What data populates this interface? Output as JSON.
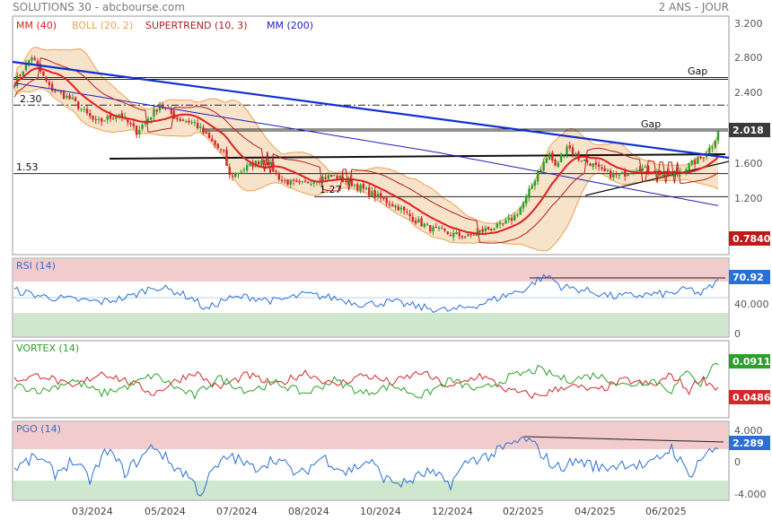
{
  "header": {
    "source": "SOLUTIONS 30 - abcbourse.com",
    "period": "2 ANS - JOUR"
  },
  "colors": {
    "ma40": "#e02020",
    "boll": "#f0a050",
    "supertrend": "#b02020",
    "ma200": "#2020c0",
    "bull": "#2ca02c",
    "bear": "#d62728",
    "blue_line": "#1030d0",
    "rsi_line": "#2a6fd6",
    "vortex_plus": "#2ca02c",
    "vortex_minus": "#d62728",
    "pgo_line": "#2a6fd6",
    "overbought_zone": "#f0c8c8",
    "oversold_zone": "#cfe5cf"
  },
  "x_axis_labels": [
    "03/2024",
    "05/2024",
    "07/2024",
    "08/2024",
    "10/2024",
    "12/2024",
    "02/2025",
    "04/2025",
    "06/2025"
  ],
  "chart_data": [
    {
      "type": "candlestick",
      "name": "price",
      "legend": [
        "MM (40)",
        "BOLL (20, 2)",
        "SUPERTREND (10, 3)",
        "MM (200)"
      ],
      "y_ticks": [
        "3.200",
        "2.800",
        "2.400",
        "1.600",
        "1.200"
      ],
      "ylim": [
        0.78,
        3.2
      ],
      "last_value": "2.018",
      "low_marker": "0.7840",
      "price_path": [
        [
          0,
          2.55
        ],
        [
          6,
          2.85
        ],
        [
          12,
          2.5
        ],
        [
          20,
          2.35
        ],
        [
          28,
          2.1
        ],
        [
          36,
          2.2
        ],
        [
          42,
          2.0
        ],
        [
          50,
          2.3
        ],
        [
          56,
          2.15
        ],
        [
          62,
          2.1
        ],
        [
          66,
          1.95
        ],
        [
          72,
          1.75
        ],
        [
          74,
          1.5
        ],
        [
          80,
          1.6
        ],
        [
          86,
          1.7
        ],
        [
          92,
          1.45
        ],
        [
          98,
          1.4
        ],
        [
          104,
          1.48
        ],
        [
          110,
          1.5
        ],
        [
          116,
          1.42
        ],
        [
          120,
          1.35
        ],
        [
          126,
          1.25
        ],
        [
          132,
          1.15
        ],
        [
          138,
          1.0
        ],
        [
          144,
          0.9
        ],
        [
          150,
          0.85
        ],
        [
          156,
          0.82
        ],
        [
          162,
          0.9
        ],
        [
          168,
          0.95
        ],
        [
          172,
          1.05
        ],
        [
          176,
          1.25
        ],
        [
          180,
          1.55
        ],
        [
          184,
          1.75
        ],
        [
          186,
          1.6
        ],
        [
          190,
          1.85
        ],
        [
          194,
          1.7
        ],
        [
          198,
          1.65
        ],
        [
          202,
          1.55
        ],
        [
          208,
          1.5
        ],
        [
          214,
          1.6
        ],
        [
          220,
          1.55
        ],
        [
          226,
          1.5
        ],
        [
          232,
          1.62
        ],
        [
          236,
          1.7
        ],
        [
          240,
          1.85
        ],
        [
          242,
          2.02
        ]
      ],
      "annotations": [
        "2.30",
        "1.53",
        "1.27",
        "Gap",
        "Gap"
      ],
      "h_levels": [
        {
          "value": 2.3,
          "label": "2.30"
        },
        {
          "value": 1.53,
          "label": "1.53"
        },
        {
          "value": 1.27,
          "label": "1.27"
        }
      ],
      "gap_levels": [
        {
          "value": 2.6,
          "label": "Gap"
        },
        {
          "value": 2.02,
          "label": "Gap"
        }
      ]
    },
    {
      "type": "line",
      "name": "RSI (14)",
      "y_ticks": [
        "40.000",
        "0"
      ],
      "last_value": "70.92",
      "ylim": [
        0,
        100
      ],
      "path": [
        [
          0,
          60
        ],
        [
          10,
          52
        ],
        [
          20,
          48
        ],
        [
          30,
          45
        ],
        [
          40,
          52
        ],
        [
          48,
          65
        ],
        [
          56,
          58
        ],
        [
          62,
          48
        ],
        [
          66,
          35
        ],
        [
          72,
          48
        ],
        [
          80,
          52
        ],
        [
          90,
          46
        ],
        [
          100,
          55
        ],
        [
          110,
          50
        ],
        [
          120,
          42
        ],
        [
          130,
          45
        ],
        [
          140,
          38
        ],
        [
          150,
          34
        ],
        [
          160,
          42
        ],
        [
          170,
          55
        ],
        [
          176,
          62
        ],
        [
          180,
          74
        ],
        [
          184,
          78
        ],
        [
          188,
          65
        ],
        [
          196,
          60
        ],
        [
          206,
          52
        ],
        [
          216,
          54
        ],
        [
          226,
          56
        ],
        [
          232,
          62
        ],
        [
          236,
          55
        ],
        [
          240,
          66
        ],
        [
          242,
          71
        ]
      ]
    },
    {
      "type": "line",
      "name": "VORTEX (14)",
      "last_values": [
        "0.0911",
        "0.0486"
      ],
      "series": [
        {
          "name": "VI+",
          "path": [
            [
              0,
              0.0
            ],
            [
              10,
              -0.02
            ],
            [
              20,
              0.02
            ],
            [
              30,
              -0.03
            ],
            [
              40,
              0.0
            ],
            [
              48,
              0.04
            ],
            [
              56,
              -0.01
            ],
            [
              62,
              -0.04
            ],
            [
              70,
              0.03
            ],
            [
              80,
              -0.02
            ],
            [
              90,
              0.01
            ],
            [
              100,
              -0.03
            ],
            [
              110,
              0.02
            ],
            [
              120,
              -0.03
            ],
            [
              130,
              0.0
            ],
            [
              140,
              -0.04
            ],
            [
              150,
              0.02
            ],
            [
              160,
              -0.02
            ],
            [
              170,
              0.03
            ],
            [
              180,
              0.06
            ],
            [
              190,
              0.02
            ],
            [
              200,
              0.04
            ],
            [
              210,
              0.0
            ],
            [
              220,
              0.02
            ],
            [
              226,
              -0.02
            ],
            [
              232,
              0.06
            ],
            [
              236,
              0.0
            ],
            [
              240,
              0.07
            ],
            [
              242,
              0.091
            ]
          ]
        },
        {
          "name": "VI-",
          "path": [
            [
              0,
              0.02
            ],
            [
              10,
              0.04
            ],
            [
              20,
              -0.01
            ],
            [
              30,
              0.05
            ],
            [
              40,
              0.01
            ],
            [
              48,
              -0.03
            ],
            [
              56,
              0.02
            ],
            [
              62,
              0.05
            ],
            [
              70,
              -0.01
            ],
            [
              80,
              0.04
            ],
            [
              90,
              0.0
            ],
            [
              100,
              0.05
            ],
            [
              110,
              0.0
            ],
            [
              120,
              0.04
            ],
            [
              130,
              0.01
            ],
            [
              140,
              0.05
            ],
            [
              150,
              -0.01
            ],
            [
              160,
              0.04
            ],
            [
              170,
              -0.02
            ],
            [
              180,
              -0.04
            ],
            [
              190,
              0.0
            ],
            [
              200,
              -0.02
            ],
            [
              210,
              0.02
            ],
            [
              220,
              0.0
            ],
            [
              226,
              0.04
            ],
            [
              232,
              -0.02
            ],
            [
              236,
              0.03
            ],
            [
              240,
              0.0
            ],
            [
              242,
              -0.01
            ]
          ]
        }
      ]
    },
    {
      "type": "line",
      "name": "PGO (14)",
      "y_ticks": [
        "4.000",
        "0",
        "-4.000"
      ],
      "last_value": "2.289",
      "ylim": [
        -5,
        5
      ],
      "path": [
        [
          0,
          -0.5
        ],
        [
          8,
          1.0
        ],
        [
          14,
          -1.2
        ],
        [
          20,
          0.5
        ],
        [
          26,
          -2.0
        ],
        [
          32,
          2.0
        ],
        [
          38,
          -1.0
        ],
        [
          44,
          1.0
        ],
        [
          48,
          2.5
        ],
        [
          54,
          0.0
        ],
        [
          60,
          -1.5
        ],
        [
          64,
          -3.8
        ],
        [
          68,
          -1.0
        ],
        [
          74,
          1.2
        ],
        [
          82,
          -0.5
        ],
        [
          90,
          0.8
        ],
        [
          98,
          -1.5
        ],
        [
          106,
          1.0
        ],
        [
          114,
          -1.0
        ],
        [
          122,
          0.5
        ],
        [
          128,
          -2.0
        ],
        [
          134,
          -2.5
        ],
        [
          142,
          -1.0
        ],
        [
          150,
          -2.5
        ],
        [
          156,
          0.5
        ],
        [
          164,
          1.2
        ],
        [
          172,
          2.8
        ],
        [
          176,
          3.3
        ],
        [
          180,
          2.0
        ],
        [
          186,
          -0.5
        ],
        [
          194,
          0.5
        ],
        [
          202,
          -0.5
        ],
        [
          210,
          0.2
        ],
        [
          218,
          -0.3
        ],
        [
          226,
          2.2
        ],
        [
          232,
          -1.5
        ],
        [
          236,
          0.8
        ],
        [
          242,
          2.29
        ]
      ]
    }
  ]
}
